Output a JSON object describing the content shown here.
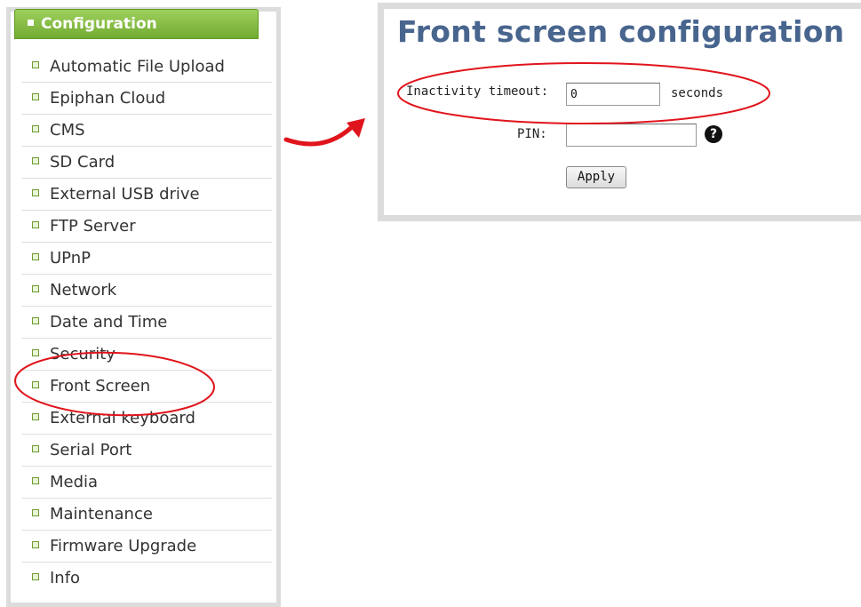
{
  "sidebar": {
    "header": "Configuration",
    "items": [
      {
        "label": "Automatic File Upload"
      },
      {
        "label": "Epiphan Cloud"
      },
      {
        "label": "CMS"
      },
      {
        "label": "SD Card"
      },
      {
        "label": "External USB drive"
      },
      {
        "label": "FTP Server"
      },
      {
        "label": "UPnP"
      },
      {
        "label": "Network"
      },
      {
        "label": "Date and Time"
      },
      {
        "label": "Security"
      },
      {
        "label": "Front Screen"
      },
      {
        "label": "External keyboard"
      },
      {
        "label": "Serial Port"
      },
      {
        "label": "Media"
      },
      {
        "label": "Maintenance"
      },
      {
        "label": "Firmware Upgrade"
      },
      {
        "label": "Info"
      }
    ]
  },
  "panel": {
    "title": "Front screen configuration",
    "inactivity_label": "Inactivity timeout:",
    "inactivity_value": "0",
    "seconds_label": "seconds",
    "pin_label": "PIN:",
    "pin_value": "",
    "apply_label": "Apply",
    "help_icon": "question-circle-icon"
  },
  "colors": {
    "header_green": "#7cb342",
    "title_blue": "#48658e",
    "annotation_red": "#e0141c"
  }
}
